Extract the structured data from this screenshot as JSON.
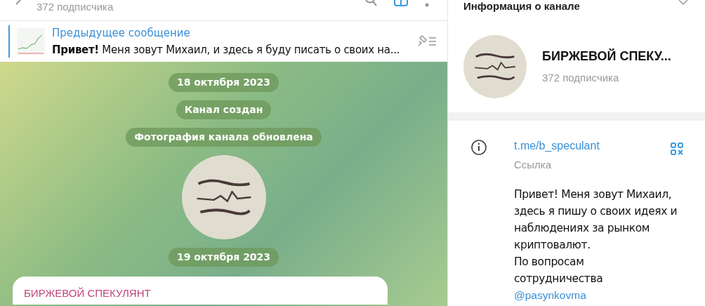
{
  "chat_header": {
    "subscribers": "372 подписчика"
  },
  "pinned": {
    "title": "Предыдущее сообщение",
    "text": "**Привет!** Меня зовут Михаил, и здесь я буду писать о своих на..."
  },
  "service_messages": [
    {
      "kind": "date",
      "text": "18 октября 2023"
    },
    {
      "kind": "event",
      "text": "Канал создан"
    },
    {
      "kind": "event",
      "text": "Фотография канала обновлена"
    },
    {
      "kind": "photo"
    },
    {
      "kind": "date",
      "text": "19 октября 2023"
    }
  ],
  "message": {
    "author": "БИРЖЕВОЙ СПЕКУЛЯНТ"
  },
  "info_panel": {
    "title": "Информация о канале",
    "name": "БИРЖЕВОЙ СПЕКУ...",
    "subscribers": "372 подписчика",
    "link": "t.me/b_speculant",
    "link_label": "Ссылка",
    "description": [
      "Привет! Меня зовут Михаил,",
      "здесь я пишу о своих идеях и",
      "наблюдениях за рынком",
      "криптовалют.",
      "По вопросам",
      "сотрудничества"
    ],
    "mention": "@pasynkovma"
  }
}
